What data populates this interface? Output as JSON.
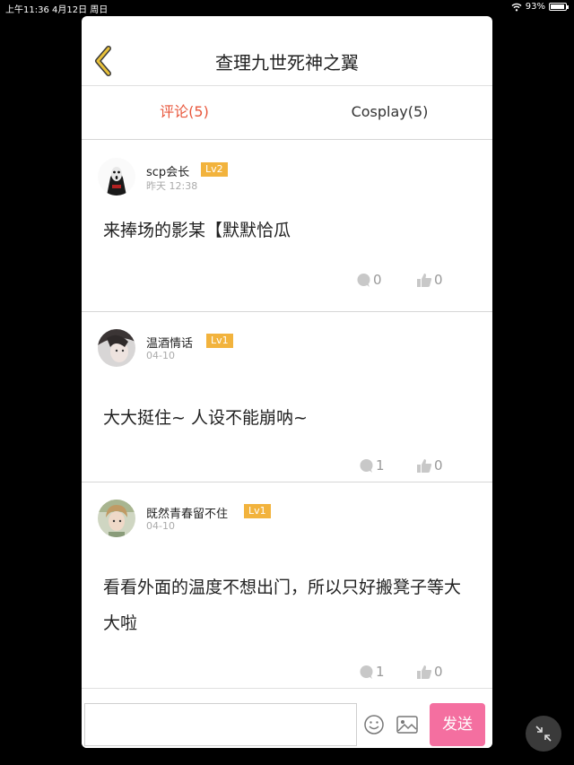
{
  "status_bar": {
    "time_date": "上午11:36  4月12日 周日",
    "battery_percent": "93%",
    "battery_level": 0.93
  },
  "header": {
    "back_icon": "chevron-left-icon",
    "title": "查理九世死神之翼"
  },
  "tabs": [
    {
      "label": "评论(5)",
      "active": true
    },
    {
      "label": "Cosplay(5)",
      "active": false
    }
  ],
  "comments": [
    {
      "username": "scp会长",
      "level": "Lv2",
      "time": "昨天 12:38",
      "content": "来捧场的影某【默默恰瓜",
      "replies": "0",
      "likes": "0"
    },
    {
      "username": "温酒情话",
      "level": "Lv1",
      "time": "04-10",
      "content": "大大挺住~ 人设不能崩呐~",
      "replies": "1",
      "likes": "0"
    },
    {
      "username": "既然青春留不住",
      "level": "Lv1",
      "time": "04-10",
      "content": "看看外面的温度不想出门，所以只好搬凳子等大大啦",
      "replies": "1",
      "likes": "0"
    }
  ],
  "input_bar": {
    "placeholder": "",
    "emoji_icon": "smiley-icon",
    "image_icon": "image-icon",
    "send_label": "发送"
  },
  "colors": {
    "active_tab": "#e8573c",
    "level_badge": "#f2b33d",
    "send_button": "#f46fa0",
    "back_chevron": "#e8c13a"
  }
}
